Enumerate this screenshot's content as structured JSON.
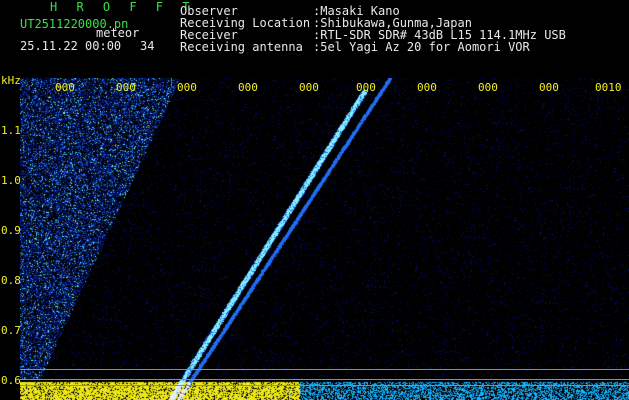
{
  "header": {
    "app_title": "H R O F F T",
    "file_name": "UT2511220000.pn",
    "meteor_label": "meteor",
    "date_time": "25.11.22 00:00",
    "meteor_count": "34"
  },
  "station_info": [
    {
      "key": "Observer",
      "value": ":Masaki Kano"
    },
    {
      "key": "Receiving Location",
      "value": ":Shibukawa,Gunma,Japan"
    },
    {
      "key": "Receiver",
      "value": ":RTL-SDR SDR# 43dB L15 114.1MHz USB"
    },
    {
      "key": "Receiving antenna",
      "value": ":5el Yagi Az 20 for Aomori VOR"
    }
  ],
  "axis": {
    "unit": "kHz",
    "y_ticks": [
      "1.1",
      "1.0",
      "0.9",
      "0.8",
      "0.7",
      "0.6"
    ],
    "x_ticks": [
      "000",
      "000",
      "000",
      "000",
      "000",
      "000",
      "000",
      "000",
      "000",
      "0010"
    ]
  },
  "colors": {
    "background": "#000000",
    "text_green": "#39e049",
    "text_white": "#e8e8e8",
    "text_yellow": "#f3f020",
    "waterfall_low": "#0a1a7a",
    "waterfall_mid": "#2a7bff",
    "waterfall_high": "#8cffc8",
    "baseline_noise": "#f3f020"
  }
}
